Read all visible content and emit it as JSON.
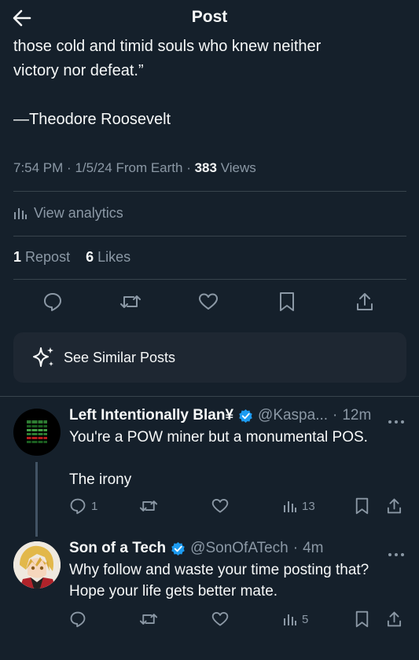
{
  "header": {
    "title": "Post",
    "back_icon": "arrow-left-icon"
  },
  "post": {
    "quote_lines": [
      "those cold and timid souls who knew neither",
      "victory nor defeat.”"
    ],
    "author_line": "—Theodore Roosevelt",
    "time": "7:54 PM",
    "date": "1/5/24",
    "source": "From Earth",
    "views_count": "383",
    "views_label": "Views",
    "analytics_label": "View analytics",
    "reposts_count": "1",
    "reposts_label": "Repost",
    "likes_count": "6",
    "likes_label": "Likes",
    "actions": [
      "reply-icon",
      "repost-icon",
      "like-icon",
      "bookmark-icon",
      "share-icon"
    ]
  },
  "similar_posts": {
    "label": "See Similar Posts",
    "icon": "sparkle-icon"
  },
  "replies": [
    {
      "name": "Left Intentionally Blan¥",
      "verified": true,
      "handle": "@Kaspa...",
      "age": "12m",
      "lines": [
        "You're a POW miner but a monumental POS.",
        "",
        "The irony"
      ],
      "reply_count": "1",
      "repost_count": "",
      "like_count": "",
      "view_count": "13"
    },
    {
      "name": "Son of a Tech",
      "verified": true,
      "handle": "@SonOfATech",
      "age": "4m",
      "lines": [
        "Why follow and waste your time posting that?",
        "Hope your life gets better mate."
      ],
      "reply_count": "",
      "repost_count": "",
      "like_count": "",
      "view_count": "5"
    }
  ],
  "colors": {
    "background": "#15202b",
    "text_primary": "#f7f9f9",
    "text_secondary": "#8b98a5",
    "verified_blue": "#1d9bf0",
    "divider": "#38444d"
  }
}
